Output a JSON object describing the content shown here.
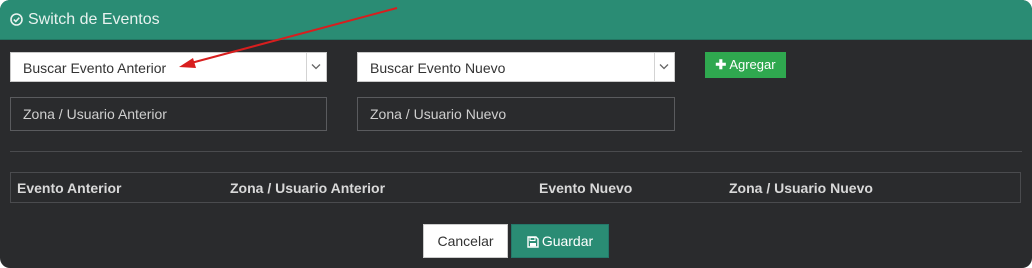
{
  "dialog": {
    "title": "Switch de Eventos",
    "title_icon": "check-circle-icon",
    "header_color": "#2a8c74"
  },
  "form": {
    "search_previous_event": {
      "value": "Buscar Evento Anterior"
    },
    "search_new_event": {
      "value": "Buscar Evento Nuevo"
    },
    "previous_zone_user": {
      "placeholder": "Zona / Usuario Anterior"
    },
    "new_zone_user": {
      "placeholder": "Zona / Usuario Nuevo"
    },
    "add_button": {
      "label": "Agregar",
      "icon": "plus-icon",
      "color": "#2fa84f"
    }
  },
  "table": {
    "columns": [
      "Evento Anterior",
      "Zona / Usuario Anterior",
      "Evento Nuevo",
      "Zona / Usuario Nuevo"
    ]
  },
  "footer": {
    "cancel_label": "Cancelar",
    "save_label": "Guardar",
    "save_icon": "floppy-disk-icon"
  },
  "annotation": {
    "arrow_color": "#d81e1e"
  }
}
